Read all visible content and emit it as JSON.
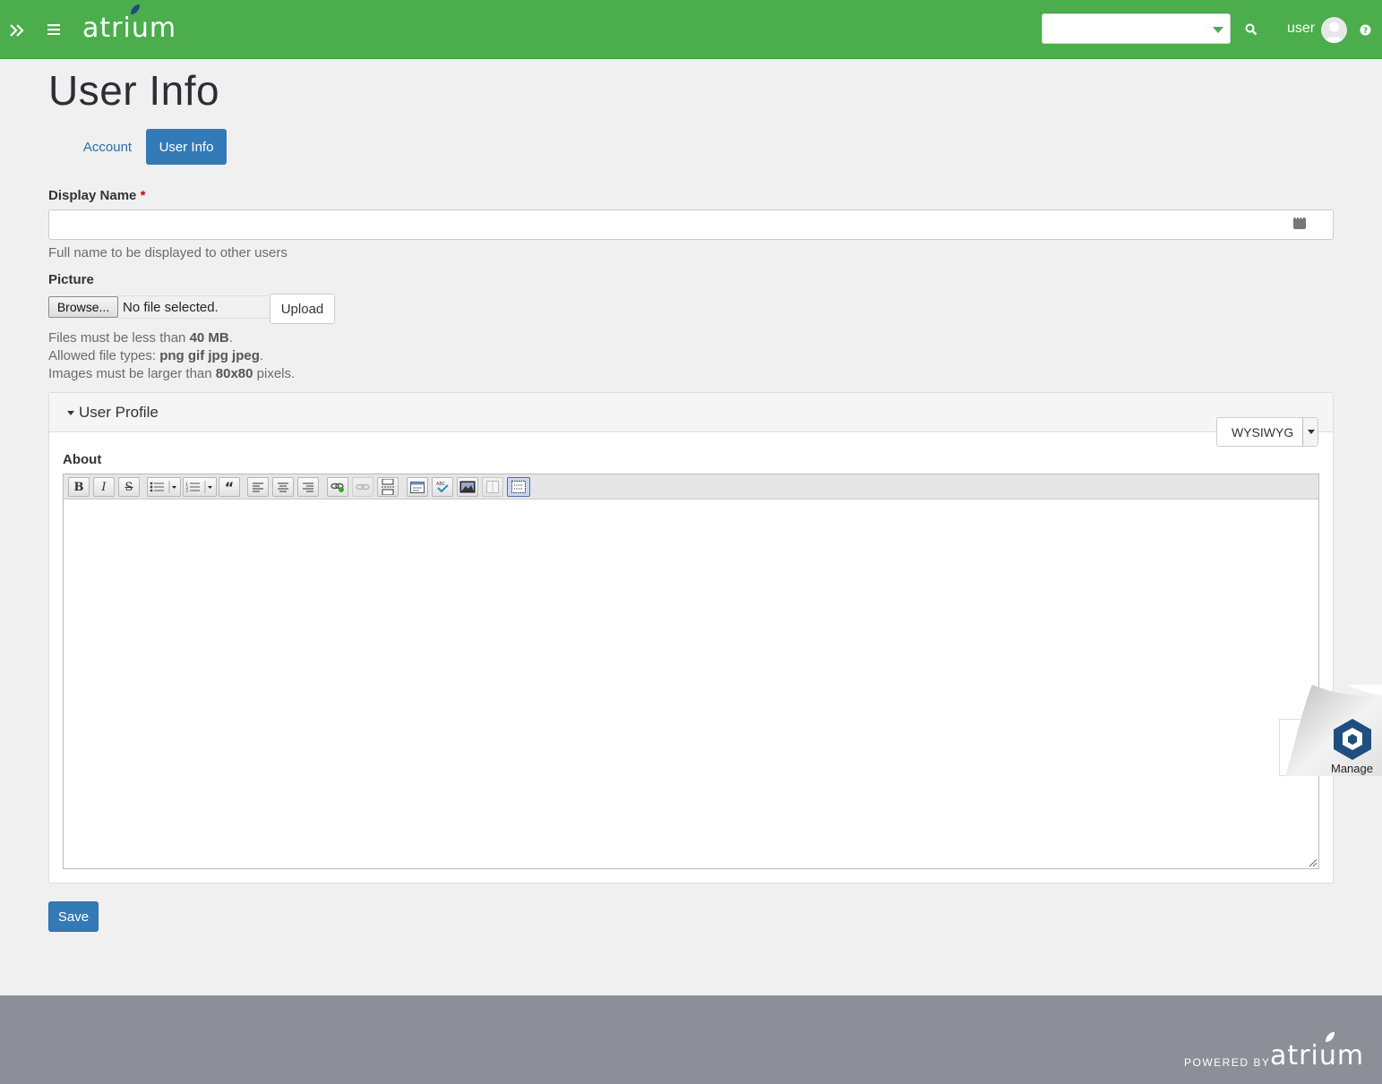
{
  "header": {
    "logo_text": "atrium",
    "user_label": "user",
    "search_select_value": ""
  },
  "page": {
    "title": "User Info"
  },
  "tabs": [
    {
      "label": "Account",
      "active": false
    },
    {
      "label": "User Info",
      "active": true
    }
  ],
  "form": {
    "display_name": {
      "label": "Display Name",
      "required_mark": "*",
      "value": "",
      "help": "Full name to be displayed to other users"
    },
    "picture": {
      "label": "Picture",
      "browse_label": "Browse...",
      "file_status": "No file selected.",
      "upload_label": "Upload",
      "help_size_prefix": "Files must be less than ",
      "help_size_value": "40 MB",
      "help_size_suffix": ".",
      "help_types_prefix": "Allowed file types: ",
      "help_types_value": "png gif jpg jpeg",
      "help_types_suffix": ".",
      "help_dims_prefix": "Images must be larger than ",
      "help_dims_value": "80x80",
      "help_dims_suffix": " pixels."
    },
    "user_profile": {
      "legend": "User Profile",
      "format_selected": "WYSIWYG",
      "about_label": "About",
      "about_value": ""
    },
    "save_label": "Save"
  },
  "manage_widget": {
    "label": "Manage"
  },
  "footer": {
    "powered_by": "POWERED BY",
    "logo_text": "atrium"
  },
  "colors": {
    "header_green": "#4bad4b",
    "primary_blue": "#337ab7",
    "footer_gray": "#8c8f97",
    "page_bg": "#f0f0f1"
  }
}
